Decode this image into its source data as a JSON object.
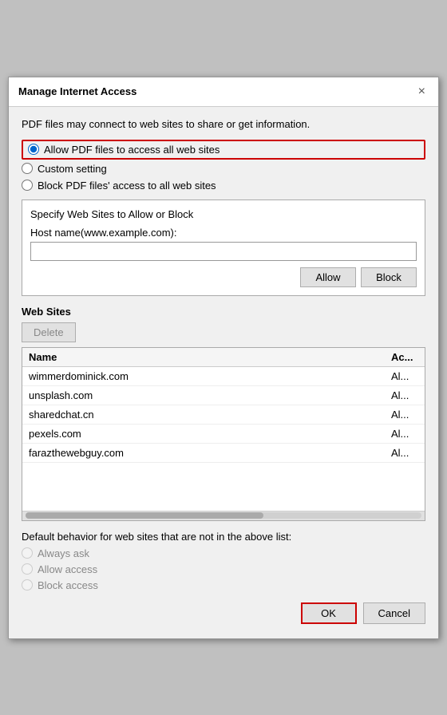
{
  "dialog": {
    "title": "Manage Internet Access",
    "close_icon": "×"
  },
  "description": "PDF files may connect to web sites to share or get information.",
  "radio_options": [
    {
      "id": "allow_all",
      "label": "Allow PDF files to access all web sites",
      "selected": true
    },
    {
      "id": "custom",
      "label": "Custom setting",
      "selected": false
    },
    {
      "id": "block_all",
      "label": "Block PDF files' access to all web sites",
      "selected": false
    }
  ],
  "specify_section": {
    "title": "Specify Web Sites to Allow or Block",
    "host_label": "Host name(www.example.com):",
    "host_placeholder": ""
  },
  "buttons": {
    "allow": "Allow",
    "block": "Block",
    "delete": "Delete",
    "ok": "OK",
    "cancel": "Cancel"
  },
  "web_sites": {
    "title": "Web Sites",
    "columns": [
      {
        "key": "name",
        "label": "Name"
      },
      {
        "key": "access",
        "label": "Ac..."
      }
    ],
    "rows": [
      {
        "name": "wimmerdominick.com",
        "access": "Al..."
      },
      {
        "name": "unsplash.com",
        "access": "Al..."
      },
      {
        "name": "sharedchat.cn",
        "access": "Al..."
      },
      {
        "name": "pexels.com",
        "access": "Al..."
      },
      {
        "name": "farazthewebguy.com",
        "access": "Al..."
      }
    ]
  },
  "default_behavior": {
    "title": "Default behavior for web sites that are not in the above list:",
    "options": [
      {
        "id": "always_ask",
        "label": "Always ask"
      },
      {
        "id": "allow_access",
        "label": "Allow access"
      },
      {
        "id": "block_access",
        "label": "Block access"
      }
    ]
  }
}
